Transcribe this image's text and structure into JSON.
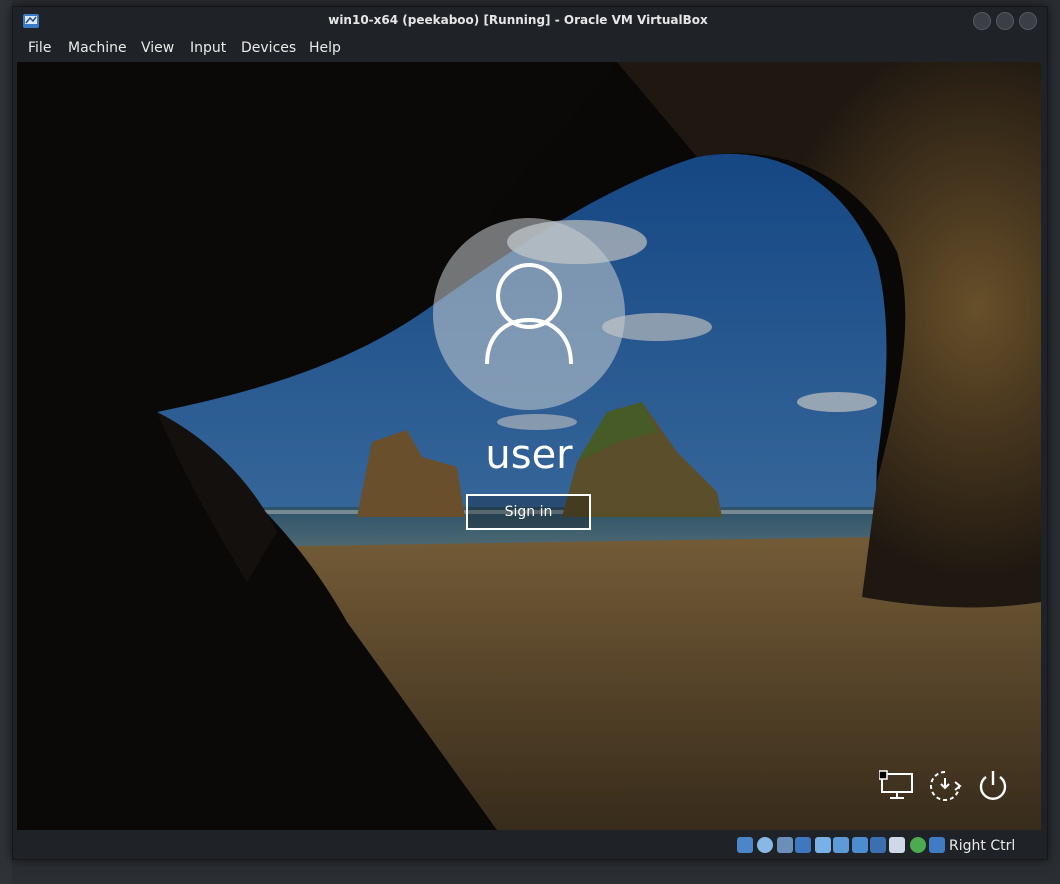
{
  "window": {
    "title": "win10-x64 (peekaboo) [Running] - Oracle VM VirtualBox"
  },
  "menu": [
    "File",
    "Machine",
    "View",
    "Input",
    "Devices",
    "Help"
  ],
  "lock_screen": {
    "username": "user",
    "sign_in_label": "Sign in",
    "corner_icons": [
      "network-icon",
      "ease-of-access-icon",
      "power-icon"
    ]
  },
  "statusbar": {
    "host_key": "Right Ctrl",
    "icons": [
      "hard-disk-icon",
      "optical-drive-icon",
      "audio-icon",
      "network-adapter-icon",
      "usb-icon",
      "shared-folders-icon",
      "display-icon",
      "video-capture-icon",
      "virtualization-icon",
      "cpu-icon",
      "mouse-integration-icon"
    ]
  },
  "colors": {
    "window_bg": "#1f2226",
    "sky": "#2e6fb5",
    "sand": "#b08a55"
  }
}
